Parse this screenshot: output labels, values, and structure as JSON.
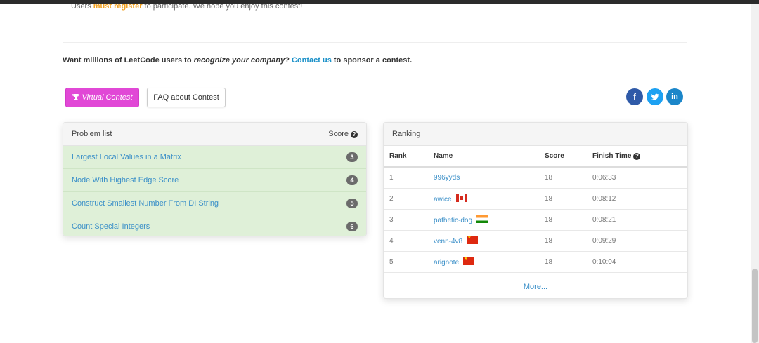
{
  "intro": {
    "prefix": "Users ",
    "accent": "must register",
    "suffix": " to participate. We hope you enjoy this contest!"
  },
  "sponsor": {
    "prefix": "Want millions of LeetCode users to ",
    "emphasis": "recognize your company",
    "middle": "? ",
    "link": "Contact us",
    "suffix": " to sponsor a contest."
  },
  "buttons": {
    "virtual_label": "Virtual Contest",
    "faq_label": "FAQ about Contest"
  },
  "social": {
    "facebook": "f",
    "twitter": "t",
    "linkedin": "in"
  },
  "problems": {
    "header": "Problem list",
    "score_header": "Score",
    "items": [
      {
        "title": "Largest Local Values in a Matrix",
        "score": "3"
      },
      {
        "title": "Node With Highest Edge Score",
        "score": "4"
      },
      {
        "title": "Construct Smallest Number From DI String",
        "score": "5"
      },
      {
        "title": "Count Special Integers",
        "score": "6"
      }
    ]
  },
  "ranking": {
    "header": "Ranking",
    "columns": {
      "rank": "Rank",
      "name": "Name",
      "score": "Score",
      "finish": "Finish Time"
    },
    "rows": [
      {
        "rank": "1",
        "name": "996yyds",
        "flag": "",
        "score": "18",
        "finish": "0:06:33"
      },
      {
        "rank": "2",
        "name": "awice",
        "flag": "ca",
        "score": "18",
        "finish": "0:08:12"
      },
      {
        "rank": "3",
        "name": "pathetic-dog",
        "flag": "in",
        "score": "18",
        "finish": "0:08:21"
      },
      {
        "rank": "4",
        "name": "venn-4v8",
        "flag": "cn",
        "score": "18",
        "finish": "0:09:29"
      },
      {
        "rank": "5",
        "name": "arignote",
        "flag": "cn",
        "score": "18",
        "finish": "0:10:04"
      }
    ],
    "more_label": "More..."
  },
  "colors": {
    "accent_orange": "#f0a020",
    "virtual_button": "#e148d6",
    "link_blue": "#3a8fc8",
    "problem_row_bg": "#dff0d8"
  }
}
